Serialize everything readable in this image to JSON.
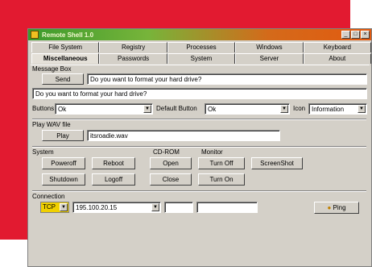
{
  "window": {
    "title": "Remote Shell 1.0"
  },
  "tabs": {
    "row1": [
      "File System",
      "Registry",
      "Processes",
      "Windows",
      "Keyboard"
    ],
    "row2": [
      "Miscellaneous",
      "Passwords",
      "System",
      "Server",
      "About"
    ],
    "active": "Miscellaneous"
  },
  "message_box": {
    "group_label": "Message Box",
    "send_label": "Send",
    "message_value": "Do you want to format your hard drive?",
    "preview_value": "Do you want to format your hard drive?",
    "buttons_label": "Buttons",
    "buttons_value": "Ok",
    "default_button_label": "Default Button",
    "default_button_value": "Ok",
    "icon_label": "Icon",
    "icon_value": "Information"
  },
  "play_wav": {
    "group_label": "Play WAV file",
    "play_label": "Play",
    "file_value": "itsroadie.wav"
  },
  "system": {
    "group_label": "System",
    "poweroff_label": "Poweroff",
    "reboot_label": "Reboot",
    "shutdown_label": "Shutdown",
    "logoff_label": "Logoff"
  },
  "cdrom": {
    "group_label": "CD-ROM",
    "open_label": "Open",
    "close_label": "Close"
  },
  "monitor": {
    "group_label": "Monitor",
    "turn_off_label": "Turn Off",
    "turn_on_label": "Turn On"
  },
  "screenshot_label": "ScreenShot",
  "connection": {
    "group_label": "Connection",
    "protocol": "TCP",
    "address": "195.100.20.15",
    "ping_label": "Ping"
  }
}
